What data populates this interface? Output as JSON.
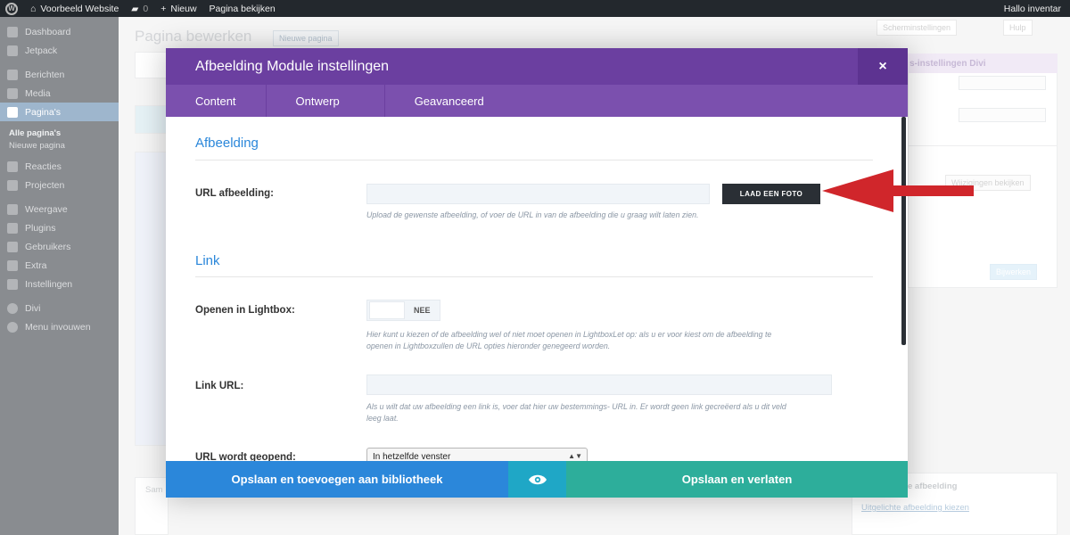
{
  "adminbar": {
    "site_name": "Voorbeeld Website",
    "comments_count": "0",
    "new_label": "Nieuw",
    "view_page": "Pagina bekijken",
    "greeting": "Hallo inventar"
  },
  "sidebar": {
    "items": [
      {
        "label": "Dashboard"
      },
      {
        "label": "Jetpack"
      },
      {
        "label": "Berichten"
      },
      {
        "label": "Media"
      },
      {
        "label": "Pagina's"
      },
      {
        "label": "Reacties"
      },
      {
        "label": "Projecten"
      },
      {
        "label": "Weergave"
      },
      {
        "label": "Plugins"
      },
      {
        "label": "Gebruikers"
      },
      {
        "label": "Extra"
      },
      {
        "label": "Instellingen"
      },
      {
        "label": "Divi"
      },
      {
        "label": "Menu invouwen"
      }
    ],
    "sub_items": [
      "Alle pagina's",
      "Nieuwe pagina"
    ]
  },
  "background": {
    "page_title": "Pagina bewerken",
    "new_page_btn": "Nieuwe pagina",
    "screen_options": "Scherminstellingen",
    "help": "Hulp",
    "divi_box_title": "s-instellingen Divi",
    "view_changes": "Wijzigingen bekijken",
    "update_btn": "Bijwerken",
    "featured_image": "e afbeelding",
    "featured_link": "Uitgelichte afbeelding kiezen",
    "excerpt_label": "Sam"
  },
  "modal": {
    "title": "Afbeelding Module instellingen",
    "close": "×",
    "tabs": [
      {
        "label": "Content"
      },
      {
        "label": "Ontwerp"
      },
      {
        "label": "Geavanceerd"
      }
    ],
    "section_image": "Afbeelding",
    "url_label": "URL afbeelding:",
    "upload_button": "LAAD EEN FOTO",
    "url_desc": "Upload de gewenste afbeelding, of voer de URL in van de afbeelding die u graag wilt laten zien.",
    "section_link": "Link",
    "lightbox_label": "Openen in Lightbox:",
    "lightbox_value": "NEE",
    "lightbox_desc": "Hier kunt u kiezen of de afbeelding wel of niet moet openen in LightboxLet op: als u er voor kiest om de afbeelding te openen in Lightboxzullen de URL opties hieronder genegeerd worden.",
    "link_url_label": "Link URL:",
    "link_url_desc": "Als u wilt dat uw afbeelding een link is, voer dat hier uw bestemmings- URL in. Er wordt geen link gecreëerd als u dit veld leeg laat.",
    "url_opens_label": "URL wordt geopend:",
    "url_opens_value": "In hetzelfde venster",
    "footer": {
      "save_library": "Opslaan en toevoegen aan bibliotheek",
      "save_exit": "Opslaan en verlaten"
    }
  },
  "colors": {
    "header": "#6b3fa0",
    "tabs": "#7b50ae",
    "accent_blue": "#2b87da",
    "accent_teal": "#2dae9b",
    "arrow_red": "#d0262b"
  }
}
